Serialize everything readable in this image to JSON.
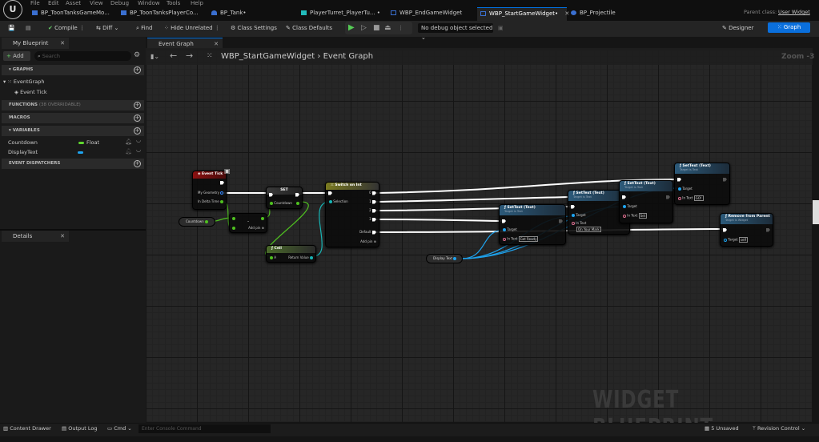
{
  "menu": [
    "File",
    "Edit",
    "Asset",
    "View",
    "Debug",
    "Window",
    "Tools",
    "Help"
  ],
  "tabs": [
    {
      "label": "BP_ToonTanksGameMo..."
    },
    {
      "label": "BP_ToonTanksPlayerCo..."
    },
    {
      "label": "BP_Tank•"
    },
    {
      "label": "PlayerTurret_PlayerTu... •"
    },
    {
      "label": "WBP_EndGameWidget"
    },
    {
      "label": "WBP_StartGameWidget•",
      "active": true
    },
    {
      "label": "BP_Projectile"
    }
  ],
  "parent_class": {
    "label": "Parent class:",
    "value": "User Widget"
  },
  "toolbar": {
    "compile": "Compile",
    "diff": "Diff",
    "find": "Find",
    "hide_unrelated": "Hide Unrelated",
    "class_settings": "Class Settings",
    "class_defaults": "Class Defaults",
    "debug_object": "No debug object selected",
    "designer": "Designer",
    "graph": "Graph"
  },
  "my_blueprint": {
    "title": "My Blueprint",
    "add": "Add",
    "search_placeholder": "Search",
    "graphs": "GRAPHS",
    "event_graph": "EventGraph",
    "event_tick": "Event Tick",
    "functions": "FUNCTIONS",
    "functions_note": "(38 OVERRIDABLE)",
    "macros": "MACROS",
    "variables": "VARIABLES",
    "vars": [
      {
        "name": "Countdown",
        "type": "Float",
        "color": "#5fd62f"
      },
      {
        "name": "DisplayText",
        "type": "",
        "color": "#1ea4f0"
      }
    ],
    "event_dispatchers": "EVENT DISPATCHERS"
  },
  "details": {
    "title": "Details"
  },
  "graph": {
    "tab": "Event Graph",
    "breadcrumb_root": "WBP_StartGameWidget",
    "breadcrumb_leaf": "Event Graph",
    "zoom": "Zoom -3",
    "watermark": "WIDGET BLUEPRINT",
    "nodes": {
      "event_tick": {
        "title": "Event Tick",
        "pins": [
          "My Geometry",
          "In Delta Time"
        ]
      },
      "set": {
        "title": "SET",
        "pin": "Countdown"
      },
      "subtract": {
        "title": "-",
        "add_pin": "Add pin"
      },
      "countdown_get": "Countdown",
      "switch": {
        "title": "Switch on Int",
        "selection": "Selection",
        "outputs": [
          "0",
          "1",
          "2",
          "3"
        ],
        "default": "Default",
        "add_pin": "Add pin"
      },
      "ceil": {
        "title": "Ceil",
        "a": "A",
        "ret": "Return Value"
      },
      "settext": [
        {
          "title": "SetText (Text)",
          "sub": "Target is Text",
          "value": "Get Ready"
        },
        {
          "title": "SetText (Text)",
          "sub": "Target is Text",
          "value": "On Your Mark"
        },
        {
          "title": "SetText (Text)",
          "sub": "Target is Text",
          "value": "Set"
        },
        {
          "title": "SetText (Text)",
          "sub": "Target is Text",
          "value": "GO!"
        }
      ],
      "target": "Target",
      "in_text": "In Text",
      "remove": {
        "title": "Remove from Parent",
        "sub": "Target is Widget",
        "value": "self"
      },
      "display_text_get": "Display Text"
    }
  },
  "status": {
    "content_drawer": "Content Drawer",
    "output_log": "Output Log",
    "cmd": "Cmd",
    "console_placeholder": "Enter Console Command",
    "unsaved": "5 Unsaved",
    "revision_control": "Revision Control"
  }
}
